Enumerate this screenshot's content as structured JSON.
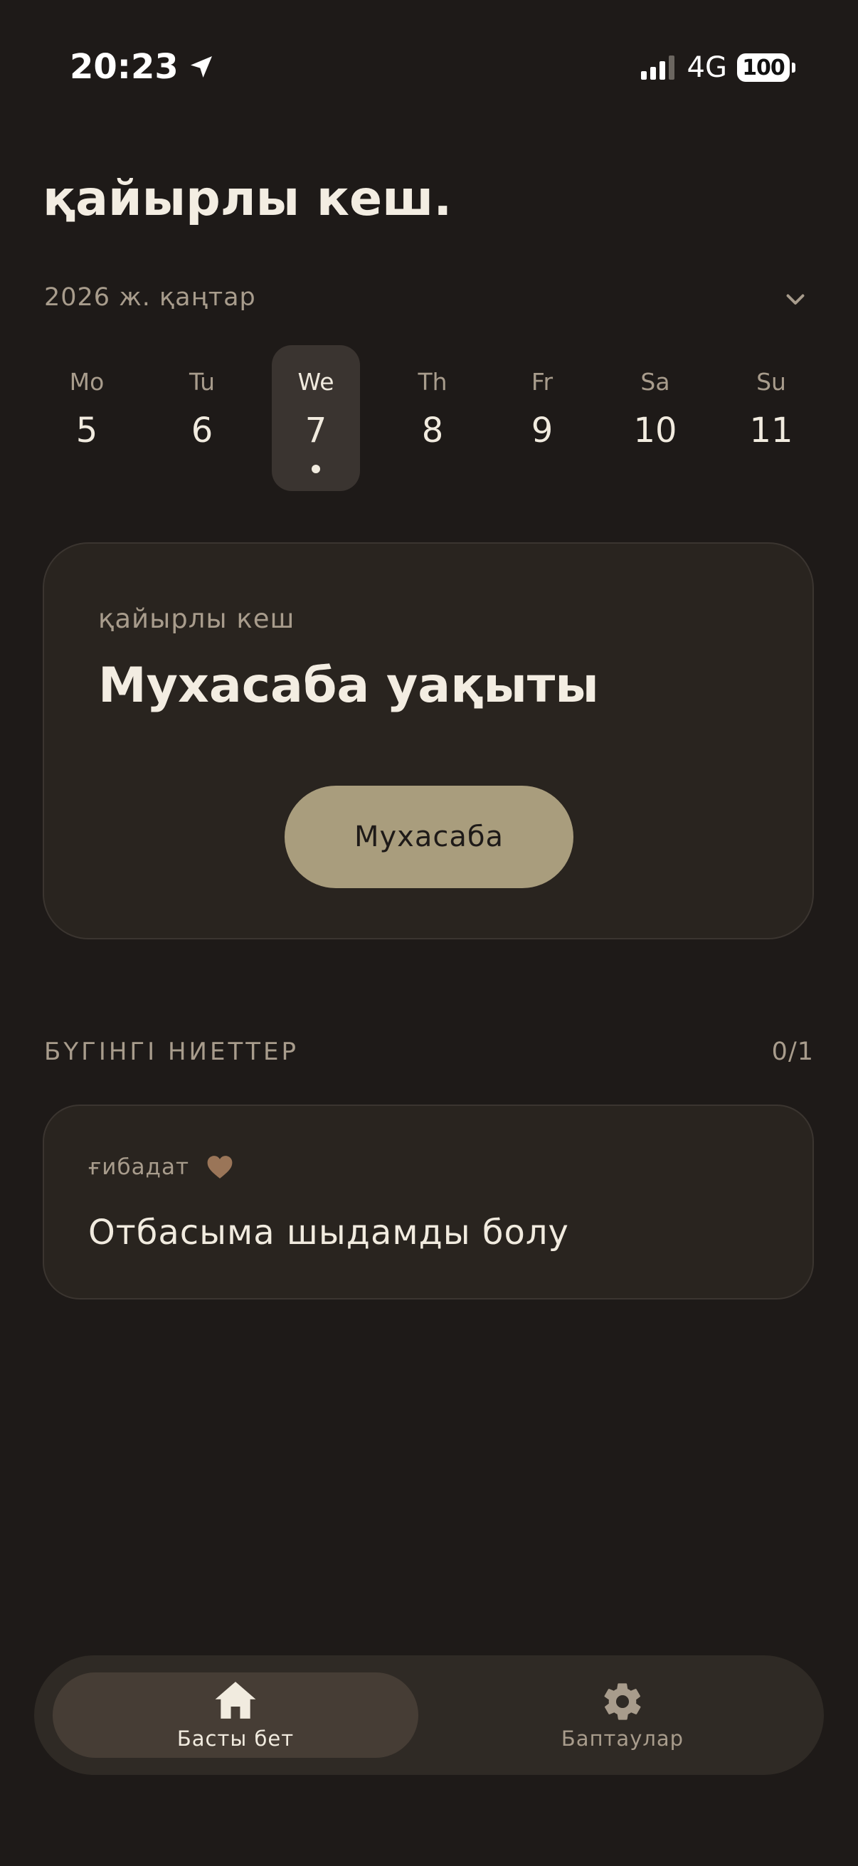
{
  "status_bar": {
    "time": "20:23",
    "network": "4G",
    "battery": "100"
  },
  "greeting": "қайырлы кеш.",
  "calendar": {
    "month_label": "2026 ж. қаңтар",
    "days": [
      {
        "name": "Mo",
        "num": "5"
      },
      {
        "name": "Tu",
        "num": "6"
      },
      {
        "name": "We",
        "num": "7"
      },
      {
        "name": "Th",
        "num": "8"
      },
      {
        "name": "Fr",
        "num": "9"
      },
      {
        "name": "Sa",
        "num": "10"
      },
      {
        "name": "Su",
        "num": "11"
      }
    ],
    "selected": "7"
  },
  "main_card": {
    "subtitle": "қайырлы кеш",
    "title": "Мухасаба уақыты",
    "button_label": "Мухасаба"
  },
  "intentions": {
    "section_title": "БҮГІНГІ НИЕТТЕР",
    "count": "0/1",
    "items": [
      {
        "category": "ғибадат",
        "text": "Отбасыма шыдамды болу"
      }
    ]
  },
  "bottom_nav": {
    "items": [
      {
        "label": "Басты бет",
        "icon": "home-icon",
        "active": true
      },
      {
        "label": "Баптаулар",
        "icon": "gear-icon",
        "active": false
      }
    ]
  },
  "colors": {
    "background": "#1e1a18",
    "card": "#29241f",
    "accent": "#a99d7d",
    "muted_text": "#a89c8c",
    "heart": "#9a7558"
  }
}
